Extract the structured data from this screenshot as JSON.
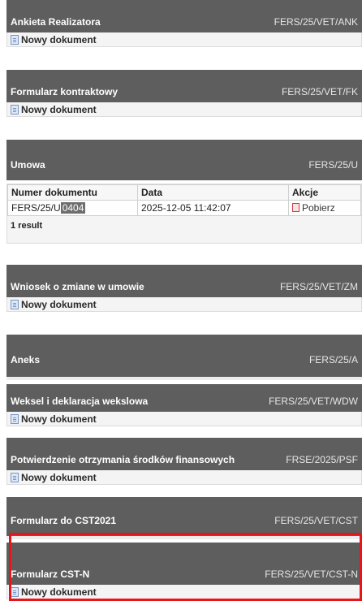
{
  "sections": [
    {
      "title": "Ankieta Realizatora",
      "code": "FERS/25/VET/ANK",
      "action": "Nowy dokument"
    },
    {
      "title": "Formularz kontraktowy",
      "code": "FERS/25/VET/FK",
      "action": "Nowy dokument"
    },
    {
      "title": "Umowa",
      "code": "FERS/25/U"
    },
    {
      "title": "Wniosek o zmiane w umowie",
      "code": "FERS/25/VET/ZM",
      "action": "Nowy dokument"
    },
    {
      "title": "Aneks",
      "code": "FERS/25/A"
    },
    {
      "title": "Weksel i deklaracja wekslowa",
      "code": "FERS/25/VET/WDW",
      "action": "Nowy dokument"
    },
    {
      "title": "Potwierdzenie otrzymania środków finansowych",
      "code": "FRSE/2025/PSF",
      "action": "Nowy dokument"
    },
    {
      "title": "Formularz do CST2021",
      "code": "FERS/25/VET/CST"
    },
    {
      "title": "Formularz CST-N",
      "code": "FERS/25/VET/CST-N",
      "action": "Nowy dokument"
    }
  ],
  "umowa_table": {
    "headers": [
      "Numer dokumentu",
      "Data",
      "Akcje"
    ],
    "row": {
      "doc_prefix": "FERS/25/U",
      "doc_redacted": "0404",
      "date": "2025-12-05 11:42:07",
      "action": "Pobierz"
    },
    "result_count": "1 result"
  }
}
